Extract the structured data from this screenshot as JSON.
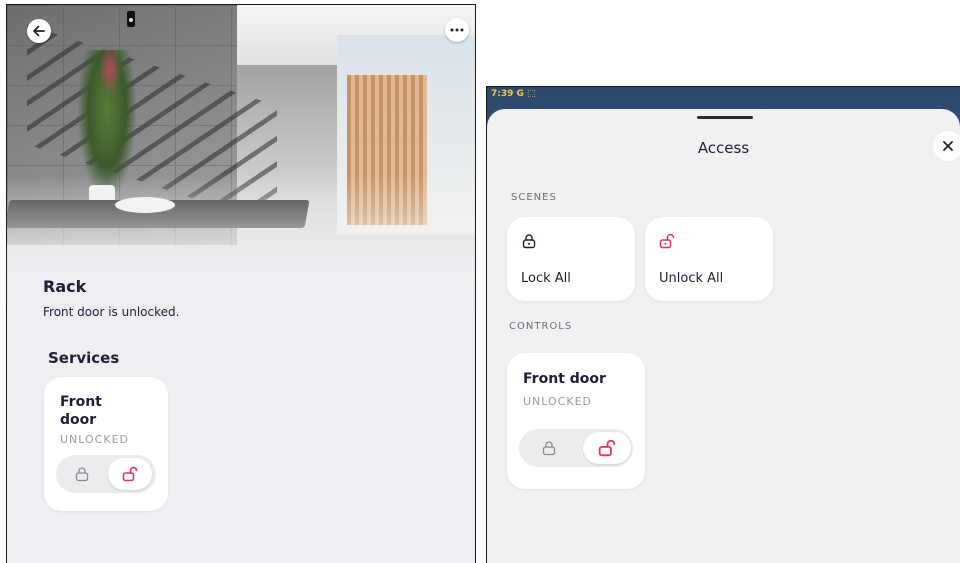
{
  "left_panel": {
    "room": {
      "name": "Rack",
      "status": "Front door is unlocked."
    },
    "services": {
      "title": "Services",
      "items": [
        {
          "name": "Front door",
          "state": "UNLOCKED"
        }
      ]
    },
    "icons": {
      "back": "arrow-left-icon",
      "more": "more-horizontal-icon"
    }
  },
  "right_panel": {
    "status_bar": {
      "time": "7:39",
      "indicators": "G ⬚"
    },
    "sheet": {
      "title": "Access",
      "sections": {
        "scenes": {
          "label": "SCENES",
          "items": [
            {
              "label": "Lock All",
              "icon": "lock-icon"
            },
            {
              "label": "Unlock All",
              "icon": "unlock-icon"
            }
          ]
        },
        "controls": {
          "label": "CONTROLS",
          "items": [
            {
              "name": "Front door",
              "state": "UNLOCKED"
            }
          ]
        }
      }
    }
  },
  "colors": {
    "unlock_accent": "#e0325f",
    "text_dark": "#1c2035",
    "muted": "#9a9aa0",
    "tile_bg": "#ffffff",
    "sheet_bg": "#f1f1f4"
  }
}
